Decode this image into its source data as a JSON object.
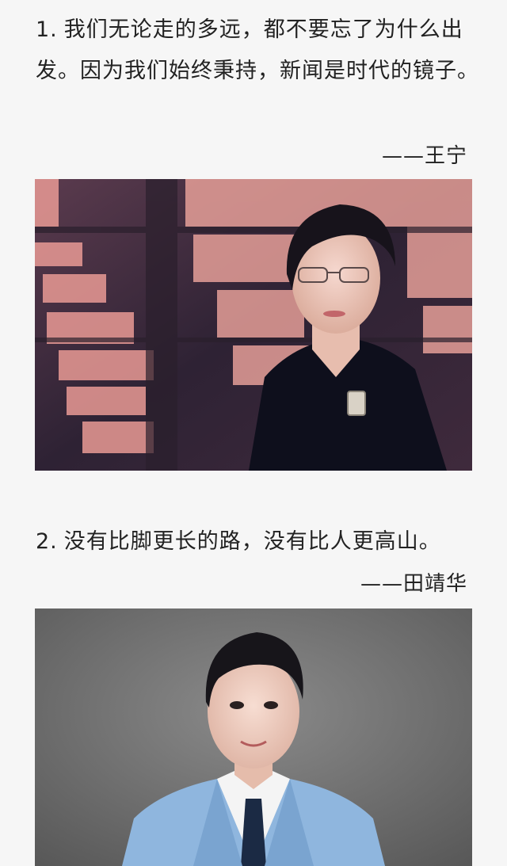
{
  "quotes": [
    {
      "number": "1.",
      "text": "我们无论走的多远，都不要忘了为什么出发。因为我们始终秉持，新闻是时代的镜子。",
      "author": "——王宁"
    },
    {
      "number": "2.",
      "text": "没有比脚更长的路，没有比人更高山。",
      "author": "——田靖华"
    }
  ],
  "colors": {
    "background": "#f6f6f6",
    "text": "#222222",
    "photo1_bg": "#3a2b40",
    "photo1_accent": "#e99a95",
    "photo2_bg": "#6b6b6b",
    "suit": "#8fb6de"
  },
  "images": [
    {
      "subject": "woman-portrait",
      "description_icon": "portrait-photo"
    },
    {
      "subject": "man-portrait",
      "description_icon": "portrait-photo"
    }
  ]
}
